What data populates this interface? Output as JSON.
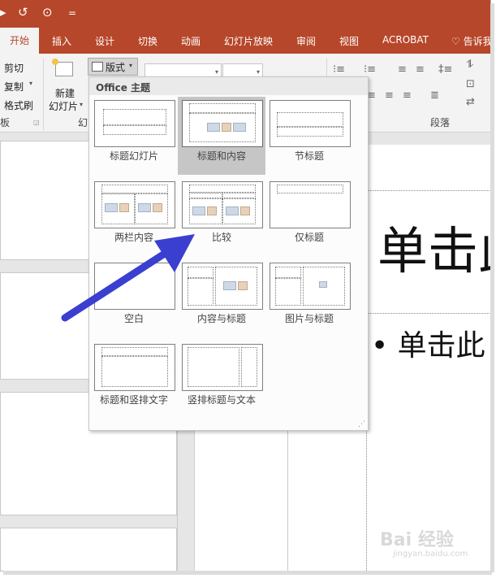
{
  "titlebar": {
    "qat": [
      "▸",
      "↺",
      "⊙",
      "="
    ]
  },
  "tabs": [
    {
      "label": "开始",
      "active": true
    },
    {
      "label": "插入"
    },
    {
      "label": "设计"
    },
    {
      "label": "切换"
    },
    {
      "label": "动画"
    },
    {
      "label": "幻灯片放映"
    },
    {
      "label": "审阅"
    },
    {
      "label": "视图"
    },
    {
      "label": "ACROBAT"
    }
  ],
  "tell_me": "告诉我",
  "ribbon": {
    "clipboard": {
      "cut": "剪切",
      "copy": "复制",
      "format_painter": "格式刷",
      "group_label": "板"
    },
    "slides": {
      "new_slide_line1": "新建",
      "new_slide_line2": "幻灯片",
      "layout_button": "版式",
      "group_label": "幻"
    },
    "paragraph": {
      "group_label": "段落"
    }
  },
  "gallery": {
    "title": "Office 主题",
    "layouts": [
      {
        "label": "标题幻灯片",
        "selected": false
      },
      {
        "label": "标题和内容",
        "selected": true
      },
      {
        "label": "节标题",
        "selected": false
      },
      {
        "label": "两栏内容",
        "selected": false
      },
      {
        "label": "比较",
        "selected": false
      },
      {
        "label": "仅标题",
        "selected": false
      },
      {
        "label": "空白",
        "selected": false
      },
      {
        "label": "内容与标题",
        "selected": false
      },
      {
        "label": "图片与标题",
        "selected": false
      },
      {
        "label": "标题和竖排文字",
        "selected": false
      },
      {
        "label": "竖排标题与文本",
        "selected": false
      }
    ]
  },
  "slide": {
    "title_text": "单击此",
    "bullet_text": "• 单击此"
  },
  "colors": {
    "accent": "#b7472a",
    "arrow": "#3b3fcf"
  },
  "watermark": {
    "brand": "Bai 经验",
    "url": "jingyan.baidu.com"
  }
}
